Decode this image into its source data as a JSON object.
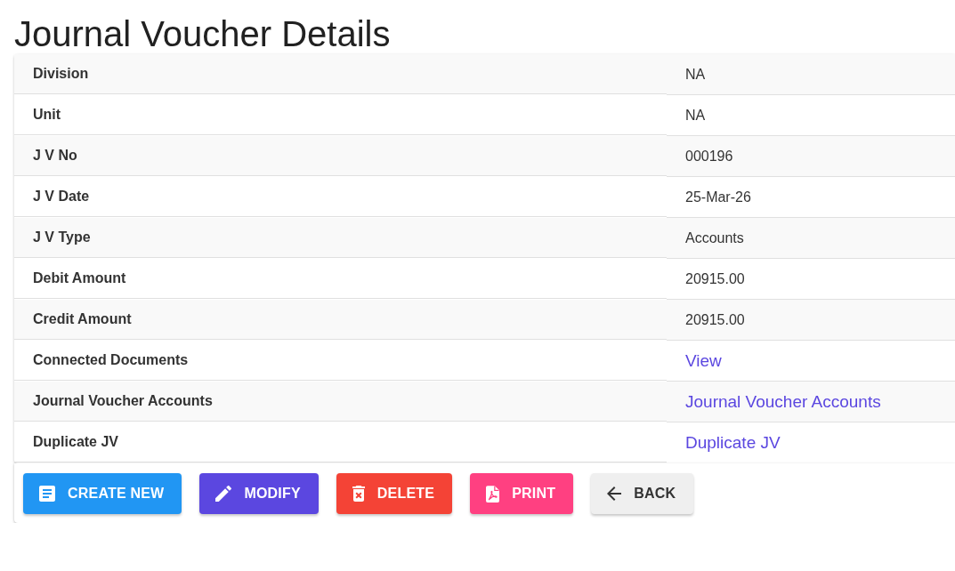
{
  "page": {
    "title": "Journal Voucher Details"
  },
  "details": [
    {
      "label": "Division",
      "value": "NA",
      "kind": "text"
    },
    {
      "label": "Unit",
      "value": "NA",
      "kind": "text"
    },
    {
      "label": "J V No",
      "value": "000196",
      "kind": "text"
    },
    {
      "label": "J V Date",
      "value": "25-Mar-26",
      "kind": "text"
    },
    {
      "label": "J V Type",
      "value": "Accounts",
      "kind": "text"
    },
    {
      "label": "Debit Amount",
      "value": "20915.00",
      "kind": "text"
    },
    {
      "label": "Credit Amount",
      "value": "20915.00",
      "kind": "text"
    },
    {
      "label": "Connected Documents",
      "value": "View",
      "kind": "link"
    },
    {
      "label": "Journal Voucher Accounts",
      "value": "Journal Voucher Accounts",
      "kind": "link"
    },
    {
      "label": "Duplicate JV",
      "value": "Duplicate JV",
      "kind": "link"
    }
  ],
  "actions": [
    {
      "label": "CREATE NEW",
      "kind": "create"
    },
    {
      "label": "MODIFY",
      "kind": "modify"
    },
    {
      "label": "DELETE",
      "kind": "delete"
    },
    {
      "label": "PRINT",
      "kind": "print"
    },
    {
      "label": "BACK",
      "kind": "back"
    }
  ]
}
